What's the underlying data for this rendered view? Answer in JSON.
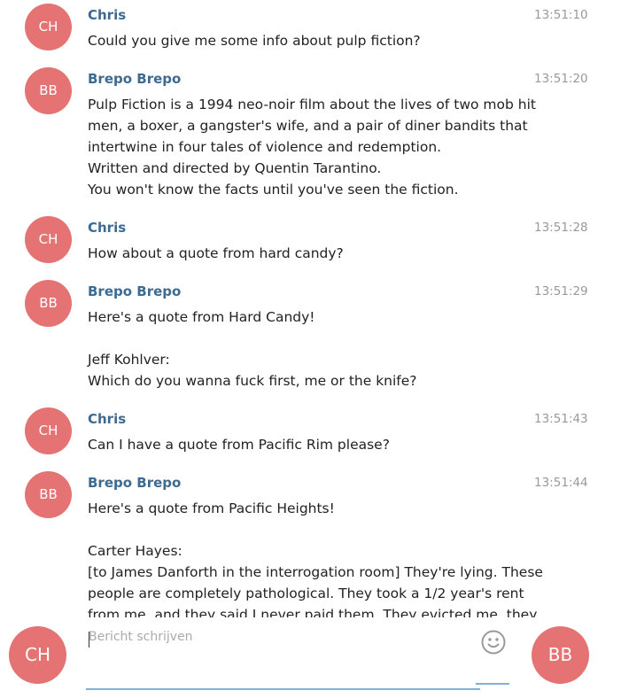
{
  "messages": [
    {
      "initials": "CH",
      "sender": "Chris",
      "time": "13:51:10",
      "lines": [
        "Could you give me some info about pulp fiction?"
      ]
    },
    {
      "initials": "BB",
      "sender": "Brepo Brepo",
      "time": "13:51:20",
      "lines": [
        "Pulp Fiction is a 1994 neo-noir film about the lives of two mob hit",
        "men, a boxer, a gangster's wife, and a pair of diner bandits that",
        "intertwine in four tales of violence and redemption.",
        "Written and directed by Quentin Tarantino.",
        "You won't know the facts until you've seen the fiction."
      ]
    },
    {
      "initials": "CH",
      "sender": "Chris",
      "time": "13:51:28",
      "lines": [
        "How about a quote from hard candy?"
      ]
    },
    {
      "initials": "BB",
      "sender": "Brepo Brepo",
      "time": "13:51:29",
      "lines": [
        "Here's a quote from Hard Candy!",
        "",
        "Jeff Kohlver:",
        "Which do you wanna fuck first, me or the knife?"
      ]
    },
    {
      "initials": "CH",
      "sender": "Chris",
      "time": "13:51:43",
      "lines": [
        "Can I have a quote from Pacific Rim please?"
      ]
    },
    {
      "initials": "BB",
      "sender": "Brepo Brepo",
      "time": "13:51:44",
      "lines": [
        "Here's a quote from Pacific Heights!",
        "",
        "Carter Hayes:",
        "[to James Danforth in the interrogation room] They're lying. These",
        "people are completely pathological. They took a 1/2 year's rent",
        "from me, and they said I never paid them. They evicted me, they"
      ]
    }
  ],
  "composer": {
    "user_initials": "CH",
    "bot_initials": "BB",
    "placeholder": "Bericht schrijven",
    "emoji_icon": "smiley-face-icon"
  },
  "colors": {
    "avatar": "#e57373",
    "sender_name": "#3d6a92",
    "timestamp": "#999999",
    "input_underline": "#7fb2d6"
  }
}
